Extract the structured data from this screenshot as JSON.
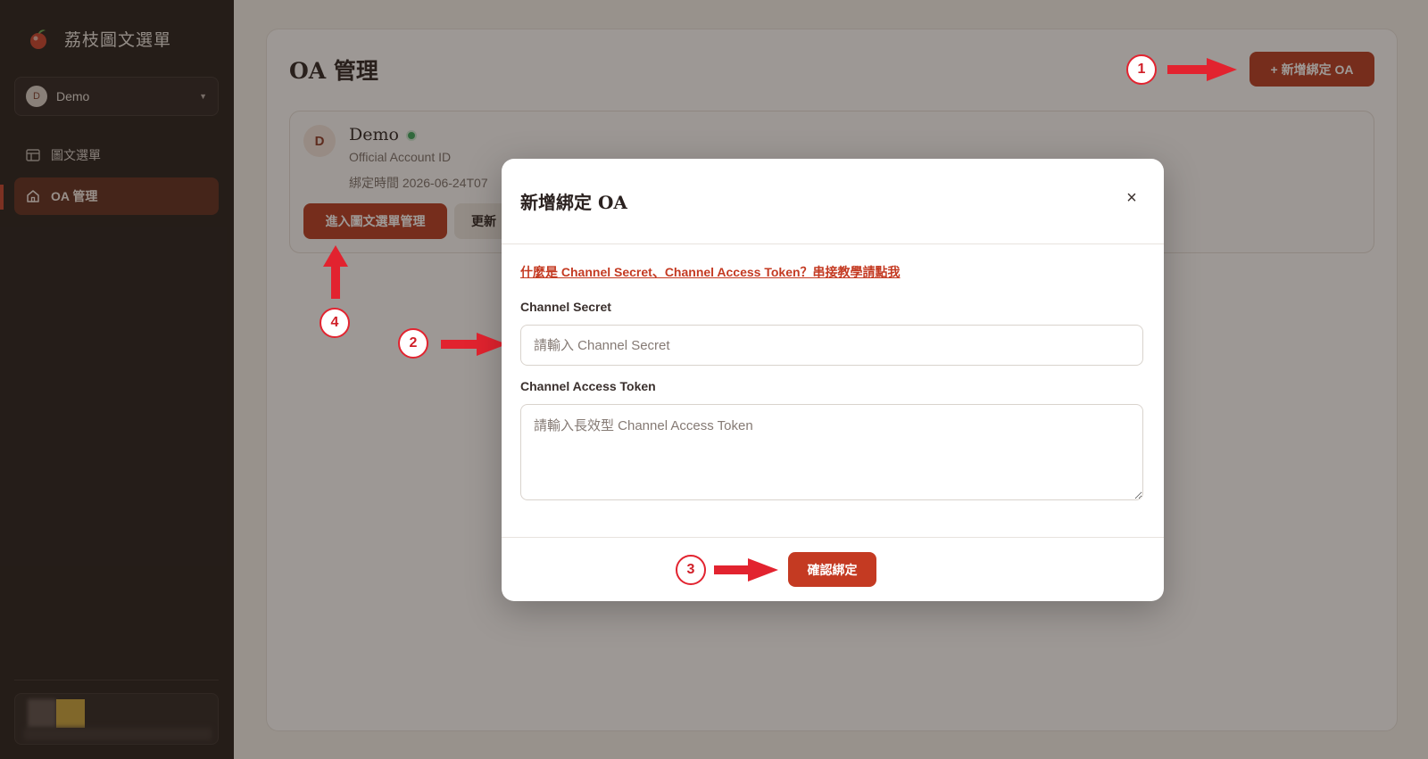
{
  "sidebar": {
    "brand_name": "荔枝圖文選單",
    "account": {
      "avatar_letter": "D",
      "name": "Demo"
    },
    "nav": [
      {
        "label": "圖文選單",
        "icon": "layout-icon"
      },
      {
        "label": "OA 管理",
        "icon": "home-icon",
        "active": true
      }
    ]
  },
  "main": {
    "title": "OA 管理",
    "add_button": "+ 新增綁定 OA",
    "oa_card": {
      "avatar_letter": "D",
      "name": "Demo",
      "status": "active",
      "id_label": "Official Account ID",
      "bound_time": "綁定時間 2026-06-24T07",
      "enter_button": "進入圖文選單管理",
      "update_button": "更新"
    }
  },
  "modal": {
    "title": "新增綁定 OA",
    "close_symbol": "×",
    "help_link": "什麼是 Channel Secret、Channel Access Token？串接教學請點我",
    "secret_label": "Channel Secret",
    "secret_placeholder": "請輸入 Channel Secret",
    "secret_value": "",
    "token_label": "Channel Access Token",
    "token_placeholder": "請輸入長效型 Channel Access Token",
    "token_value": "",
    "confirm_button": "確認綁定"
  },
  "annotations": [
    {
      "number": "1"
    },
    {
      "number": "2"
    },
    {
      "number": "3"
    },
    {
      "number": "4"
    }
  ],
  "colors": {
    "accent": "#b6391f",
    "sidebar_bg": "#231c19",
    "annotation_red": "#e2232f",
    "status_green": "#3aa55a"
  }
}
